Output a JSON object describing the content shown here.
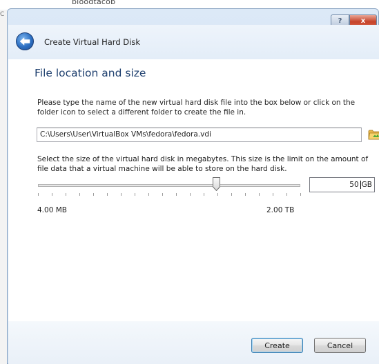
{
  "background": {
    "partial_text": "bloodtacob",
    "left_mark": "C"
  },
  "window": {
    "help_label": "?",
    "close_label": "x",
    "title": "Create Virtual Hard Disk"
  },
  "page": {
    "section_title": "File location and size",
    "location_instructions": "Please type the name of the new virtual hard disk file into the box below or click on the folder icon to select a different folder to create the file in.",
    "file_path": "C:\\Users\\User\\VirtualBox VMs\\fedora\\fedora.vdi",
    "size_instructions": "Select the size of the virtual hard disk in megabytes. This size is the limit on the amount of file data that a virtual machine will be able to store on the hard disk.",
    "slider": {
      "min_label": "4.00 MB",
      "max_label": "2.00 TB",
      "position_fraction": 0.68
    },
    "size": {
      "value": "50",
      "unit": "GB"
    }
  },
  "buttons": {
    "create": "Create",
    "cancel": "Cancel"
  },
  "icons": {
    "back": "back-arrow-icon",
    "folder": "folder-icon"
  },
  "colors": {
    "section_title": "#1e3f6e",
    "frame": "#cddff2",
    "close_button": "#c6442b"
  }
}
